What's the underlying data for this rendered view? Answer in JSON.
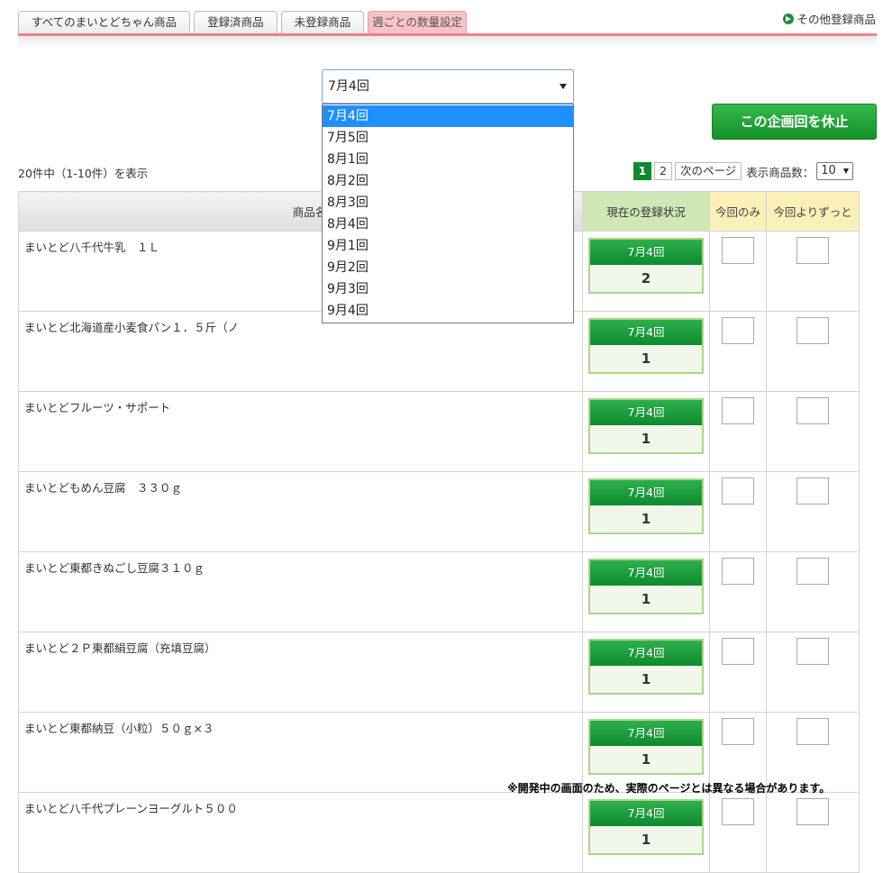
{
  "tabs": [
    {
      "label": "すべてのまいとどちゃん商品",
      "active": false
    },
    {
      "label": "登録済商品",
      "active": false
    },
    {
      "label": "未登録商品",
      "active": false
    },
    {
      "label": "週ごとの数量設定",
      "active": true
    }
  ],
  "other_link": "その他登録商品",
  "week_select": {
    "value": "7月4回",
    "options": [
      "7月4回",
      "7月5回",
      "8月1回",
      "8月2回",
      "8月3回",
      "8月4回",
      "9月1回",
      "9月2回",
      "9月3回",
      "9月4回"
    ]
  },
  "pause_button": "この企画回を休止",
  "count_text": "20件中（1-10件）を表示",
  "pager": {
    "pages": [
      "1",
      "2"
    ],
    "current": "1",
    "next": "次のページ",
    "per_label": "表示商品数：",
    "per_value": "10"
  },
  "table": {
    "headers": {
      "name": "商品名",
      "status": "現在の登録状況",
      "once": "今回のみ",
      "always": "今回よりずっと"
    },
    "rows": [
      {
        "name": "まいとど八千代牛乳　１Ｌ",
        "week": "7月4回",
        "qty": "2"
      },
      {
        "name": "まいとど北海道産小麦食パン１．５斤（ノ",
        "week": "7月4回",
        "qty": "1"
      },
      {
        "name": "まいとどフルーツ・サポート",
        "week": "7月4回",
        "qty": "1"
      },
      {
        "name": "まいとどもめん豆腐　３３０ｇ",
        "week": "7月4回",
        "qty": "1"
      },
      {
        "name": "まいとど東都きぬごし豆腐３１０ｇ",
        "week": "7月4回",
        "qty": "1"
      },
      {
        "name": "まいとど２Ｐ東都絹豆腐（充填豆腐）",
        "week": "7月4回",
        "qty": "1"
      },
      {
        "name": "まいとど東都納豆（小粒）５０ｇ×３",
        "week": "7月4回",
        "qty": "1"
      },
      {
        "name": "まいとど八千代プレーンヨーグルト５００",
        "week": "7月4回",
        "qty": "1"
      }
    ]
  },
  "footnote": "※開発中の画面のため、実際のページとは異なる場合があります。",
  "colors": {
    "accent_green": "#0e8a2e",
    "tab_pink": "#f8c3c7",
    "select_blue": "#1e90ff"
  }
}
